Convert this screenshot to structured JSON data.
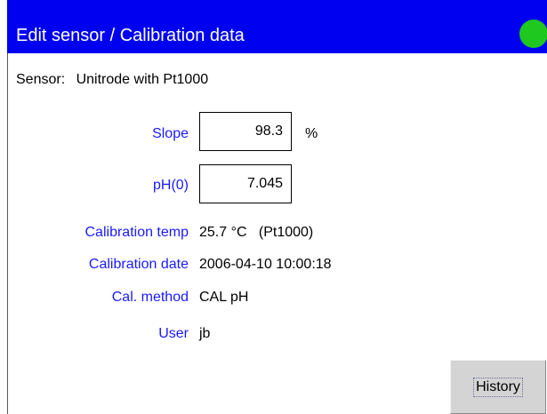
{
  "titlebar": {
    "title": "Edit sensor / Calibration data",
    "status_color": "#1ec81e"
  },
  "sensor": {
    "label": "Sensor:",
    "value": "Unitrode with Pt1000"
  },
  "fields": {
    "slope": {
      "label": "Slope",
      "value": "98.3",
      "unit": "%"
    },
    "ph0": {
      "label": "pH(0)",
      "value": "7.045"
    },
    "calibration_temp": {
      "label": "Calibration temp",
      "value": "25.7 °C   (Pt1000)"
    },
    "calibration_date": {
      "label": "Calibration date",
      "value": "2006-04-10 10:00:18"
    },
    "cal_method": {
      "label": "Cal. method",
      "value": "CAL pH"
    },
    "user": {
      "label": "User",
      "value": "jb"
    }
  },
  "buttons": {
    "history_label": "History"
  },
  "colors": {
    "titlebar_bg": "#0000f0",
    "label_text": "#1a1aff",
    "button_bg": "#d4d4d4"
  }
}
